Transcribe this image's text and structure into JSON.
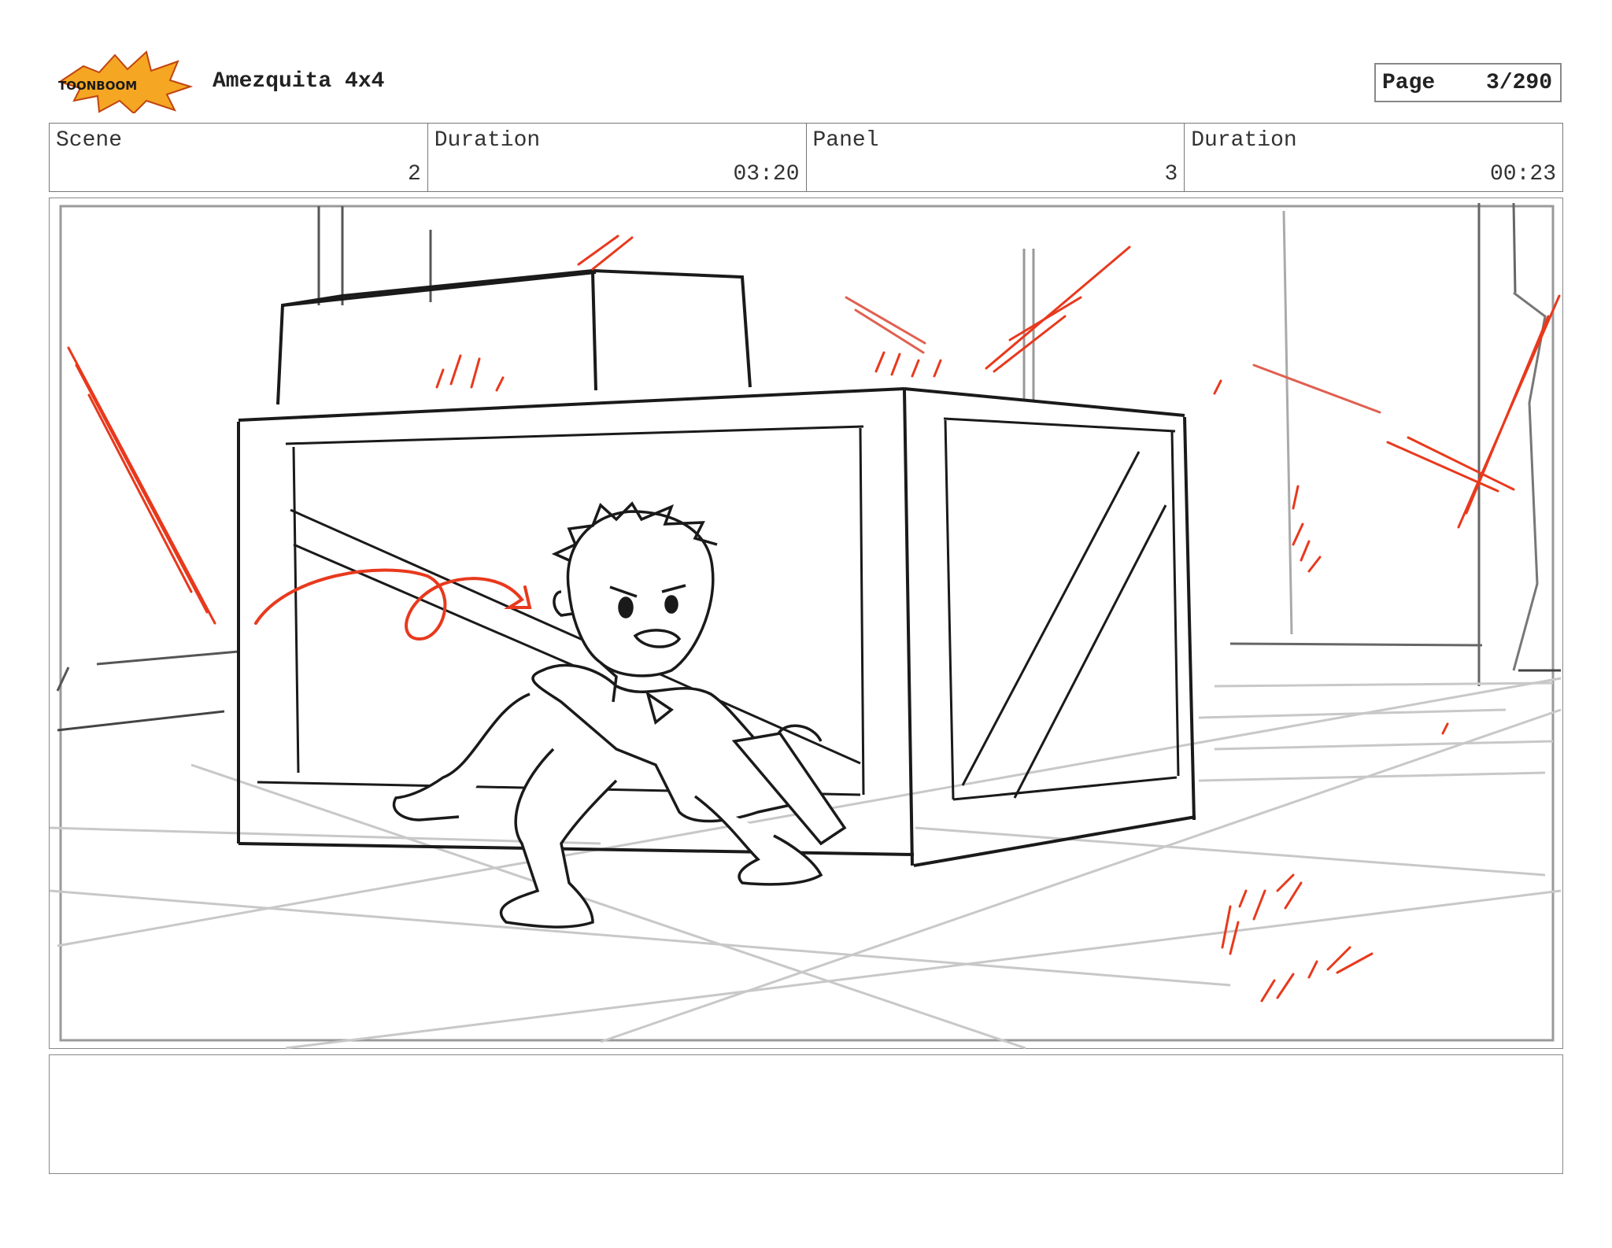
{
  "header": {
    "logo_text": "TOONBOOM",
    "project_title": "Amezquita 4x4",
    "page_label": "Page",
    "page_value": "3/290"
  },
  "info": [
    {
      "label": "Scene",
      "value": "2"
    },
    {
      "label": "Duration",
      "value": "03:20"
    },
    {
      "label": "Panel",
      "value": "3"
    },
    {
      "label": "Duration",
      "value": "00:23"
    }
  ],
  "colors": {
    "sketch_line": "#1a1a1a",
    "guide_line": "#bdbdbd",
    "accent_red": "#e8391d",
    "logo_orange": "#f5a623",
    "logo_dark": "#1a1a1a"
  },
  "notes": {
    "text": ""
  }
}
